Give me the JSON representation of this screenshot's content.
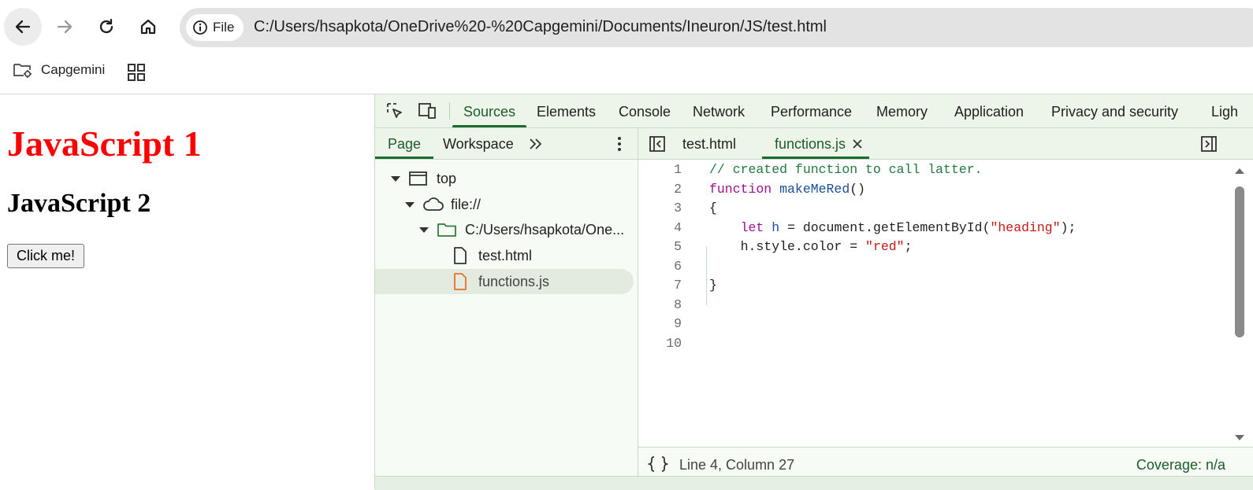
{
  "browser": {
    "nav": {
      "back": "back-arrow-icon",
      "forward": "forward-arrow-icon",
      "reload": "reload-icon",
      "home": "home-icon"
    },
    "address_chip_label": "File",
    "url": "C:/Users/hsapkota/OneDrive%20-%20Capgemini/Documents/Ineuron/JS/test.html",
    "bookmarks": [
      {
        "label": "Capgemini"
      }
    ]
  },
  "page": {
    "heading1": "JavaScript 1",
    "heading1_color": "#ff0000",
    "heading2": "JavaScript 2",
    "button_label": "Click me!"
  },
  "devtools": {
    "tabs": [
      {
        "label": "Sources",
        "active": true
      },
      {
        "label": "Elements"
      },
      {
        "label": "Console"
      },
      {
        "label": "Network"
      },
      {
        "label": "Performance"
      },
      {
        "label": "Memory"
      },
      {
        "label": "Application"
      },
      {
        "label": "Privacy and security"
      },
      {
        "label": "Ligh"
      }
    ],
    "navigator": {
      "tabs": [
        {
          "label": "Page",
          "active": true
        },
        {
          "label": "Workspace"
        }
      ],
      "tree": [
        {
          "label": "top",
          "icon": "frame-icon"
        },
        {
          "label": "file://",
          "icon": "cloud-icon"
        },
        {
          "label": "C:/Users/hsapkota/One...",
          "icon": "folder-icon"
        },
        {
          "label": "test.html",
          "icon": "file-icon"
        },
        {
          "label": "functions.js",
          "icon": "js-file-icon",
          "selected": true
        }
      ]
    },
    "editor": {
      "tabs": [
        {
          "label": "test.html"
        },
        {
          "label": "functions.js",
          "active": true,
          "closable": true
        }
      ],
      "lines": [
        "// created function to call latter.",
        "function makeMeRed()",
        "{",
        "    let h = document.getElementById(\"heading\");",
        "    h.style.color = \"red\";",
        "",
        "}",
        "",
        "",
        ""
      ],
      "line_numbers": [
        "1",
        "2",
        "3",
        "4",
        "5",
        "6",
        "7",
        "8",
        "9",
        "10"
      ],
      "status_position": "Line 4, Column 27",
      "coverage": "Coverage: n/a"
    },
    "accent_color": "#1e6b32"
  }
}
